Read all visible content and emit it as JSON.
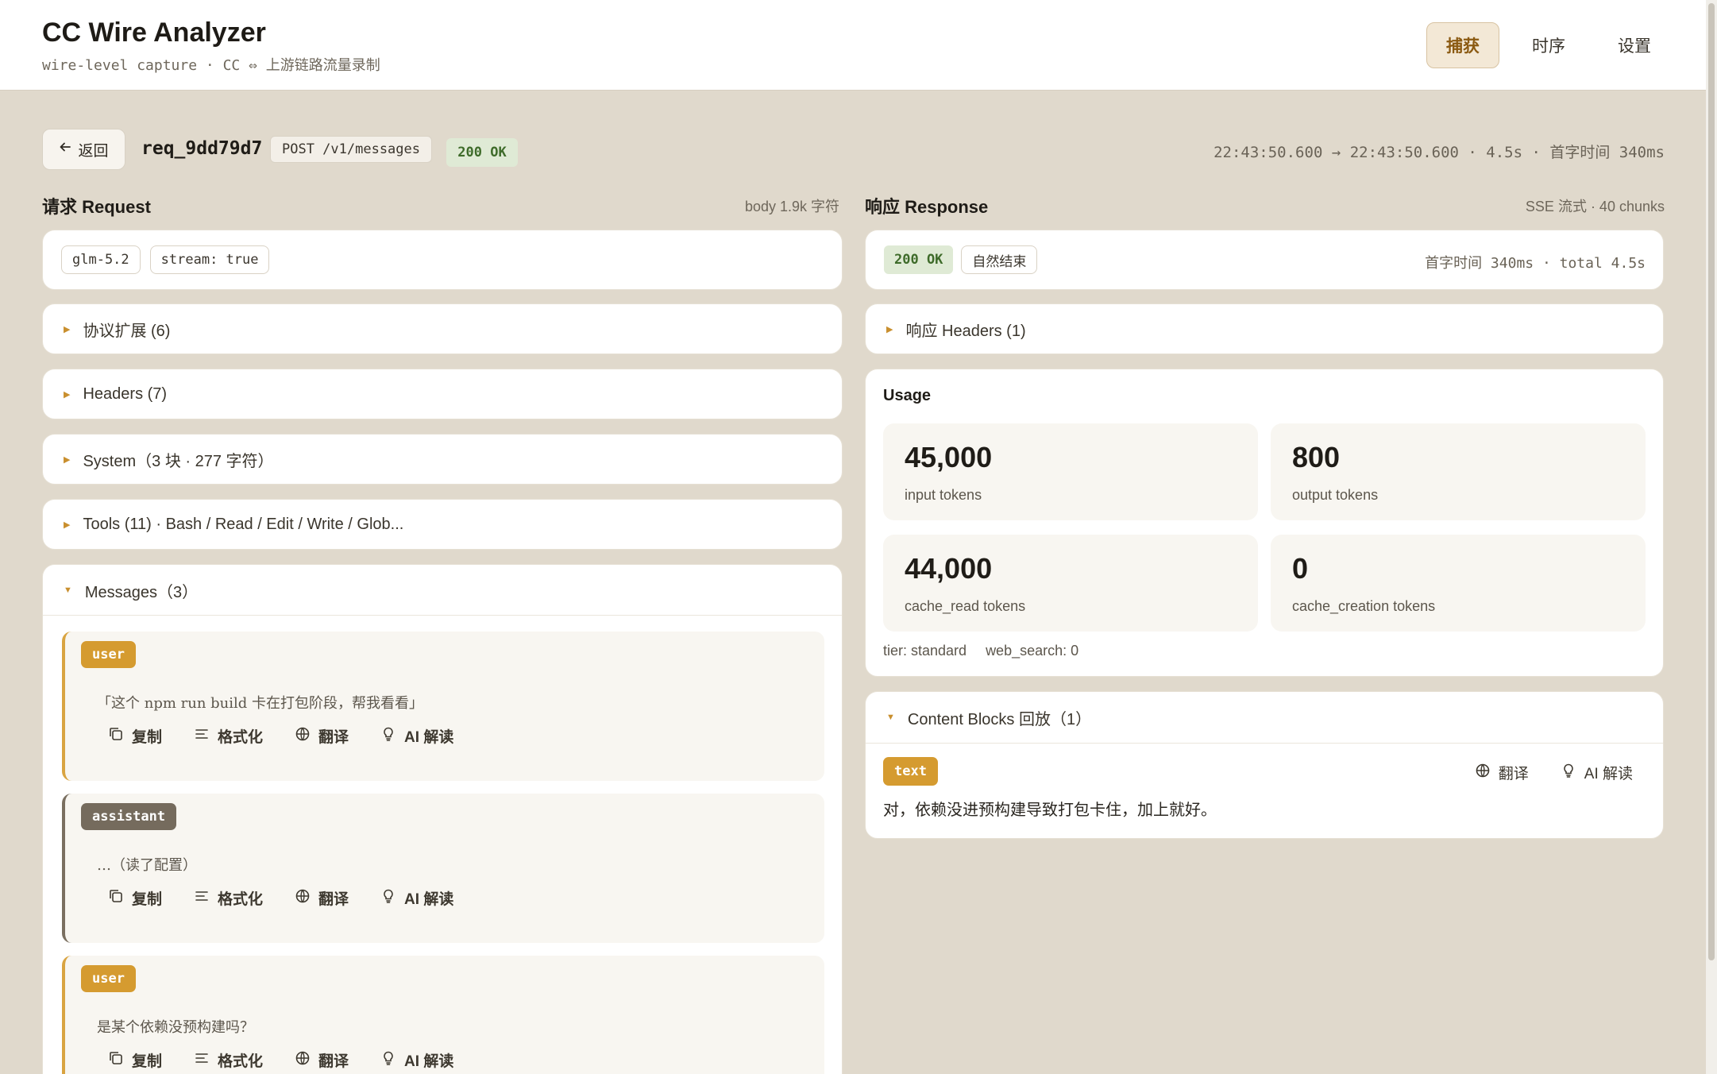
{
  "app": {
    "title": "CC Wire Analyzer",
    "subtitle": "wire-level capture · CC ⇔ 上游链路流量录制",
    "nav": [
      "捕获",
      "时序",
      "设置"
    ],
    "nav_active": 0
  },
  "request_bar": {
    "back_label": "返回",
    "request_id": "req_9dd79d7",
    "method_path": "POST /v1/messages",
    "status": "200 OK",
    "timing": "22:43:50.600 → 22:43:50.600 · 4.5s · 首字时间 340ms"
  },
  "request": {
    "title": "请求 Request",
    "meta": "body 1.9k 字符",
    "chips": [
      "glm-5.2",
      "stream: true"
    ],
    "sections": [
      "协议扩展 (6)",
      "Headers (7)",
      "System（3 块 · 277 字符）",
      "Tools (11) · Bash / Read / Edit / Write / Glob..."
    ],
    "messages_label": "Messages（3）",
    "messages": [
      {
        "role": "user",
        "text": "「这个 npm run build 卡在打包阶段，帮我看看」"
      },
      {
        "role": "assistant",
        "text": "…（读了配置）"
      },
      {
        "role": "user",
        "text": "是某个依赖没预构建吗？"
      }
    ],
    "actions": [
      "复制",
      "格式化",
      "翻译",
      "AI 解读"
    ]
  },
  "response": {
    "title": "响应 Response",
    "meta": "SSE 流式 · 40 chunks",
    "status": "200 OK",
    "finish": "自然结束",
    "timing": "首字时间 340ms · total 4.5s",
    "headers_label": "响应 Headers (1)",
    "usage": {
      "title": "Usage",
      "stats": [
        {
          "value": "45,000",
          "label": "input tokens"
        },
        {
          "value": "800",
          "label": "output tokens"
        },
        {
          "value": "44,000",
          "label": "cache_read tokens"
        },
        {
          "value": "0",
          "label": "cache_creation tokens"
        }
      ],
      "tier": "tier: standard",
      "web_search": "web_search: 0"
    },
    "content_blocks": {
      "label": "Content Blocks 回放（1）",
      "type": "text",
      "text": "对，依赖没进预构建导致打包卡住，加上就好。",
      "actions": [
        "翻译",
        "AI 解读"
      ]
    }
  },
  "colors": {
    "background": "#e0d9cc",
    "accent": "#d59b30",
    "status_ok": "#3e6b2a"
  }
}
